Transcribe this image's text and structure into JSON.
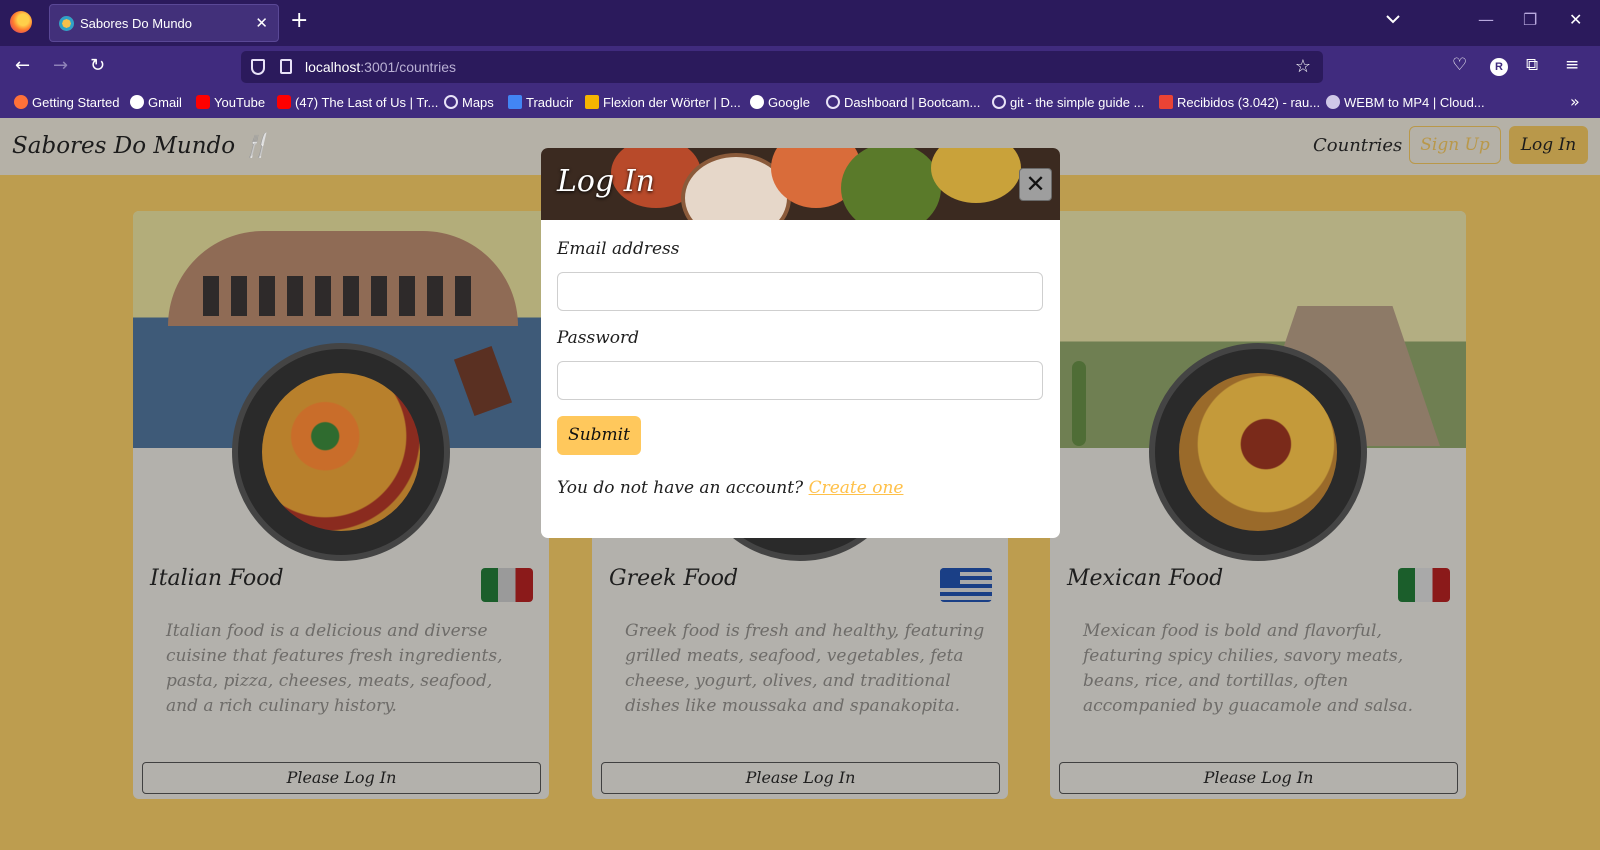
{
  "browser": {
    "tab_title": "Sabores Do Mundo",
    "url_host": "localhost",
    "url_path": ":3001/countries",
    "profile_initial": "R",
    "bookmarks": [
      {
        "label": "Getting Started",
        "color": "#ff7139"
      },
      {
        "label": "Gmail",
        "color": "#ffffff"
      },
      {
        "label": "YouTube",
        "color": "#ff0000"
      },
      {
        "label": "(47) The Last of Us | Tr...",
        "color": "#ff0000"
      },
      {
        "label": "Maps",
        "color": "#e8e2f7"
      },
      {
        "label": "Traducir",
        "color": "#4285f4"
      },
      {
        "label": "Flexion der Wörter | D...",
        "color": "#f5b400"
      },
      {
        "label": "Google",
        "color": "#ffffff"
      },
      {
        "label": "Dashboard | Bootcam...",
        "color": "#e8e2f7"
      },
      {
        "label": "git - the simple guide ...",
        "color": "#e8e2f7"
      },
      {
        "label": "Recibidos (3.042) - rau...",
        "color": "#ea4335"
      },
      {
        "label": "WEBM to MP4 | Cloud...",
        "color": "#d0c8e8"
      }
    ]
  },
  "site": {
    "brand": "Sabores Do Mundo 🍴",
    "nav_countries": "Countries",
    "sign_up": "Sign Up",
    "log_in": "Log In"
  },
  "cards": [
    {
      "title": "Italian Food",
      "description": "Italian food is a delicious and diverse cuisine that features fresh ingredients, pasta, pizza, cheeses, meats, seafood, and a rich culinary history.",
      "button": "Please Log In"
    },
    {
      "title": "Greek Food",
      "description": "Greek food is fresh and healthy, featuring grilled meats, seafood, vegetables, feta cheese, yogurt, olives, and traditional dishes like moussaka and spanakopita.",
      "button": "Please Log In"
    },
    {
      "title": "Mexican Food",
      "description": "Mexican food is bold and flavorful, featuring spicy chilies, savory meats, beans, rice, and tortillas, often accompanied by guacamole and salsa.",
      "button": "Please Log In"
    }
  ],
  "modal": {
    "title": "Log In",
    "email_label": "Email address",
    "email_value": "",
    "password_label": "Password",
    "password_value": "",
    "submit": "Submit",
    "prompt": "You do not have an account?",
    "link": "Create one"
  },
  "colors": {
    "chrome_dark": "#2b1a5c",
    "chrome": "#402b7e",
    "accent": "#ffc85c",
    "page_bg": "#bd9d4f"
  }
}
